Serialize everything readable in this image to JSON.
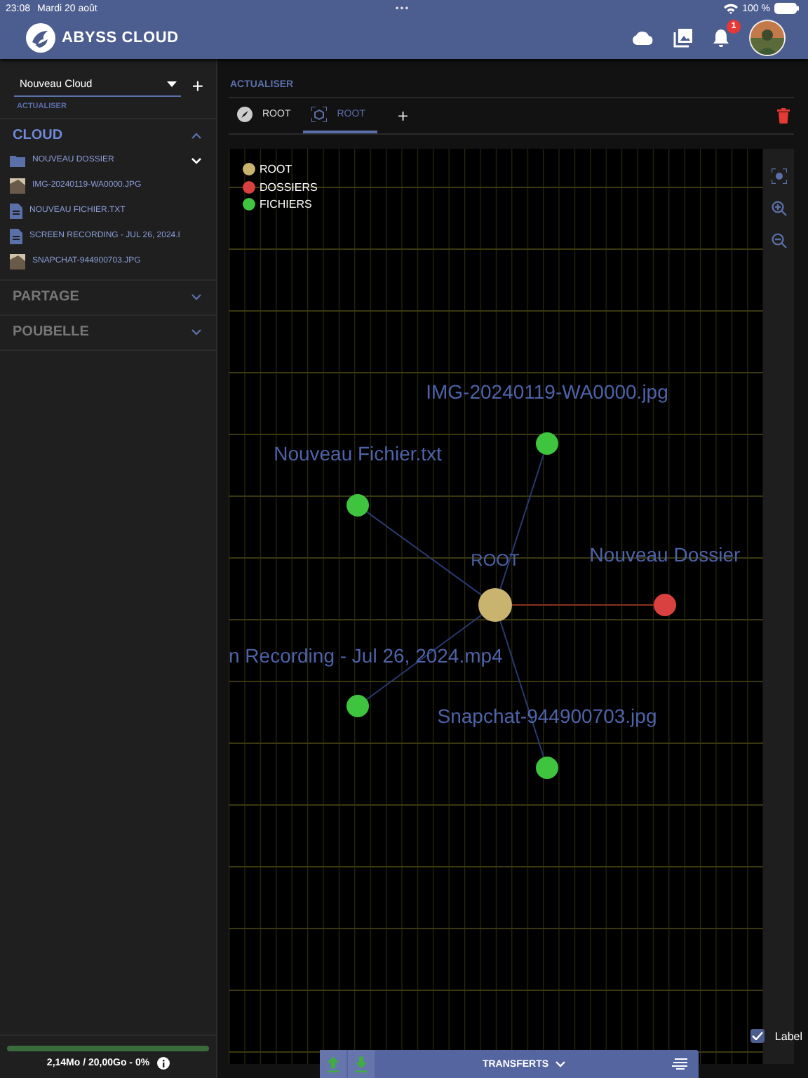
{
  "status_bar": {
    "time": "23:08",
    "date": "Mardi 20 août",
    "dots": "•••",
    "battery": "100 %"
  },
  "header": {
    "title": "ABYSS CLOUD",
    "notifications": "1"
  },
  "sidebar": {
    "cloud_select": {
      "value": "Nouveau Cloud"
    },
    "add": "+",
    "refresh": "ACTUALISER",
    "sections": [
      {
        "title": "CLOUD",
        "expanded": true,
        "items": [
          {
            "kind": "folder",
            "name": "NOUVEAU DOSSIER"
          },
          {
            "name": "IMG-20240119-WA0000.JPG"
          },
          {
            "kind": "file",
            "name": "NOUVEAU FICHIER.TXT"
          },
          {
            "kind": "file",
            "name": "SCREEN RECORDING - JUL 26, 2024.I"
          },
          {
            "name": "SNAPCHAT-944900703.JPG"
          }
        ]
      },
      {
        "title": "PARTAGE",
        "expanded": false
      },
      {
        "title": "POUBELLE",
        "expanded": false
      }
    ],
    "storage": {
      "text": "2,14Mo / 20,00Go - 0%"
    }
  },
  "main": {
    "refresh": "ACTUALISER",
    "tabs": [
      {
        "kind": "explorer",
        "label": "ROOT",
        "selected": false
      },
      {
        "kind": "graph",
        "label": "ROOT",
        "selected": true
      }
    ],
    "add_tab": "+",
    "graph": {
      "legend": [
        {
          "kind": "root",
          "label": "ROOT",
          "color": "#c8b46e"
        },
        {
          "kind": "folder",
          "label": "DOSSIERS",
          "color": "#d94040"
        },
        {
          "kind": "file",
          "label": "FICHIERS",
          "color": "#3fc43f"
        }
      ],
      "nodes": [
        {
          "kind": "file",
          "label": "IMG-20240119-WA0000.jpg"
        },
        {
          "kind": "file",
          "label": "Nouveau Fichier.txt"
        },
        {
          "kind": "root",
          "label": "ROOT"
        },
        {
          "kind": "folder",
          "label": "Nouveau Dossier"
        },
        {
          "kind": "file",
          "label": "n Recording - Jul 26, 2024.mp4"
        },
        {
          "kind": "file",
          "label": "Snapchat-944900703.jpg"
        }
      ],
      "label_toggle": {
        "label": "Label",
        "checked": true
      }
    },
    "transfers": {
      "title": "TRANSFERTS"
    }
  }
}
